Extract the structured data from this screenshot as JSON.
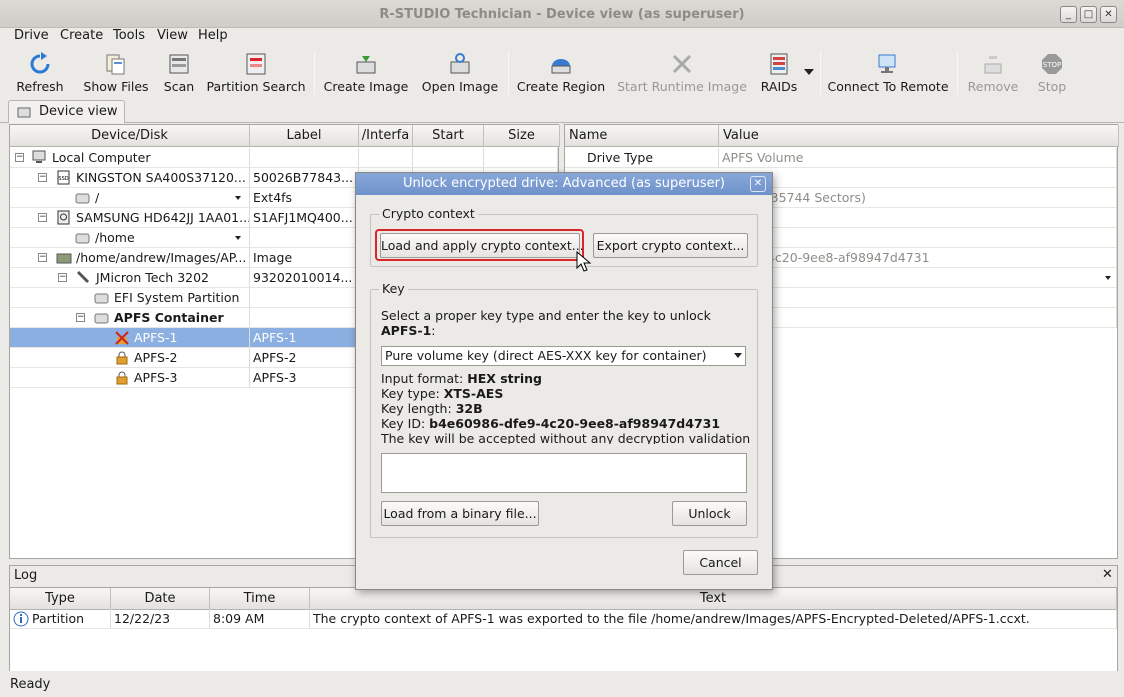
{
  "window": {
    "title": "R-STUDIO Technician - Device view (as superuser)"
  },
  "menu": [
    "Drive",
    "Create",
    "Tools",
    "View",
    "Help"
  ],
  "toolbar": {
    "refresh": "Refresh",
    "show_files": "Show Files",
    "scan": "Scan",
    "partition_search": "Partition Search",
    "create_image": "Create Image",
    "open_image": "Open Image",
    "create_region": "Create Region",
    "start_runtime_image": "Start Runtime Image",
    "raids": "RAIDs",
    "connect_remote": "Connect To Remote",
    "remove": "Remove",
    "stop": "Stop"
  },
  "tabs": {
    "device_view": "Device view"
  },
  "device_table": {
    "headers": [
      "Device/Disk",
      "Label",
      "/Interfa",
      "Start",
      "Size"
    ],
    "rows": [
      {
        "name": "Local Computer",
        "label": ""
      },
      {
        "name": "KINGSTON SA400S37120...",
        "label": "50026B77843..."
      },
      {
        "name": "/",
        "label": "Ext4fs"
      },
      {
        "name": "SAMSUNG HD642JJ 1AA01...",
        "label": "S1AFJ1MQ400..."
      },
      {
        "name": "/home",
        "label": ""
      },
      {
        "name": "/home/andrew/Images/AP...",
        "label": "Image"
      },
      {
        "name": "JMicron Tech 3202",
        "label": "93202010014..."
      },
      {
        "name": "EFI System Partition",
        "label": ""
      },
      {
        "name": "APFS Container",
        "label": ""
      },
      {
        "name": "APFS-1",
        "label": "APFS-1"
      },
      {
        "name": "APFS-2",
        "label": "APFS-2"
      },
      {
        "name": "APFS-3",
        "label": "APFS-3"
      }
    ]
  },
  "props_table": {
    "headers": [
      "Name",
      "Value"
    ],
    "rows": [
      {
        "name": "Drive Type",
        "value": "APFS Volume"
      },
      {
        "name": "",
        "value": "3 (124635744 Sectors)"
      },
      {
        "name": "",
        "value": "6-dfe9-4c20-9ee8-af98947d4731"
      },
      {
        "name": "",
        "value": "ectors)"
      }
    ]
  },
  "dialog": {
    "title": "Unlock encrypted drive: Advanced (as superuser)",
    "crypto_group": "Crypto context",
    "load_apply": "Load and apply crypto context...",
    "export": "Export crypto context...",
    "key_group": "Key",
    "instruction": "Select a proper key type and enter the key to unlock",
    "volume": "APFS-1",
    "key_type_select": "Pure volume key (direct AES-XXX key for container)",
    "input_format_label": "Input format:",
    "input_format": "HEX string",
    "key_type_label": "Key type:",
    "key_type": "XTS-AES",
    "key_length_label": "Key length:",
    "key_length": "32B",
    "key_id_label": "Key ID:",
    "key_id": "b4e60986-dfe9-4c20-9ee8-af98947d4731",
    "warning": "The key will be accepted without any decryption validation",
    "key_input_value": "",
    "load_binary": "Load from a binary file...",
    "unlock": "Unlock",
    "cancel": "Cancel"
  },
  "log": {
    "title": "Log",
    "headers": [
      "Type",
      "Date",
      "Time",
      "Text"
    ],
    "rows": [
      {
        "type": "Partition",
        "date": "12/22/23",
        "time": "8:09 AM",
        "text": "The crypto context of APFS-1 was exported to the file /home/andrew/Images/APFS-Encrypted-Deleted/APFS-1.ccxt."
      }
    ]
  },
  "status": "Ready",
  "colors": {
    "selection": "#8bafe0",
    "dialog_title": "#7596cd",
    "highlight": "#d9262a"
  }
}
